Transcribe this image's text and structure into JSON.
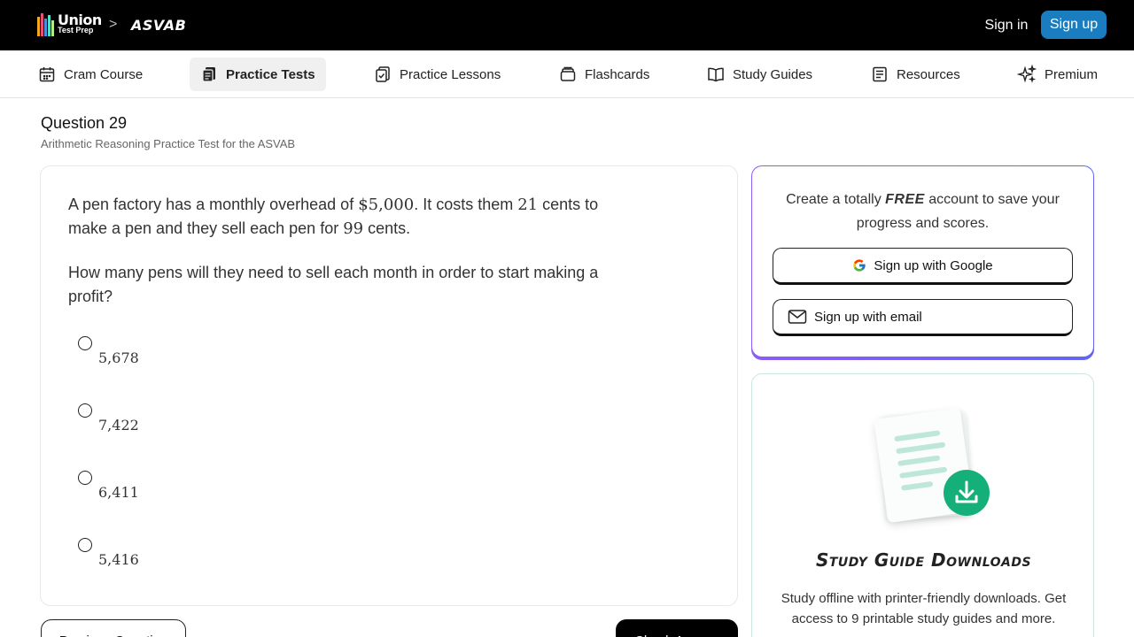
{
  "header": {
    "logo_line1": "Union",
    "logo_line2": "Test Prep",
    "breadcrumb_separator": ">",
    "breadcrumb_page": "ASVAB",
    "sign_in": "Sign in",
    "sign_up": "Sign up",
    "accent_color": "#1a7dbf"
  },
  "nav": {
    "items": [
      {
        "label": "Cram Course",
        "icon": "calendar-icon"
      },
      {
        "label": "Practice Tests",
        "icon": "practice-tests-icon",
        "active": true
      },
      {
        "label": "Practice Lessons",
        "icon": "clipboard-check-icon"
      },
      {
        "label": "Flashcards",
        "icon": "cards-icon"
      },
      {
        "label": "Study Guides",
        "icon": "book-open-icon"
      },
      {
        "label": "Resources",
        "icon": "document-list-icon"
      },
      {
        "label": "Premium",
        "icon": "sparkles-icon"
      }
    ]
  },
  "question": {
    "title": "Question 29",
    "subtitle": "Arithmetic Reasoning Practice Test for the ASVAB",
    "para1_a": "A pen factory has a monthly overhead of ",
    "para1_m1": "$5,000",
    "para1_b": ". It costs them ",
    "para1_m2": "21",
    "para1_c": " cents to make a pen and they sell each pen for ",
    "para1_m3": "99",
    "para1_d": " cents.",
    "para2": "How many pens will they need to sell each month in order to start making a profit?",
    "options": [
      "5,678",
      "7,422",
      "6,411",
      "5,416"
    ],
    "prev_label": "Previous Question",
    "check_label": "Check Answer"
  },
  "signup_card": {
    "msg_a": "Create a totally ",
    "msg_free": "FREE",
    "msg_b": " account to save your progress and scores.",
    "google_label": "Sign up with Google",
    "email_label": "Sign up with email"
  },
  "guide_card": {
    "title": "Study Guide Downloads",
    "text": "Study offline with printer-friendly downloads. Get access to 9 printable study guides and more.",
    "accent_color": "#15b07a"
  }
}
